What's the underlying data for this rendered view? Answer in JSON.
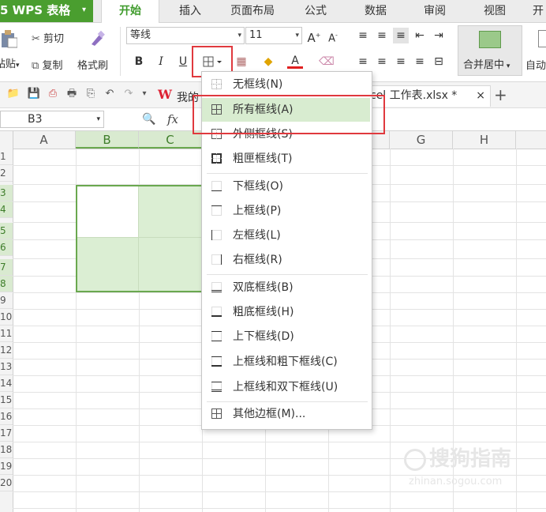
{
  "app_menu": {
    "label": "5 WPS 表格",
    "arrow": "▾"
  },
  "tabs": [
    "开始",
    "插入",
    "页面布局",
    "公式",
    "数据",
    "审阅",
    "视图",
    "开"
  ],
  "ribbon": {
    "cut": "剪切",
    "paste": "粘贴",
    "copy": "复制",
    "format_painter": "格式刷",
    "font_name": "等线",
    "font_size": "11",
    "bold": "B",
    "italic": "I",
    "underline": "U",
    "merge_center": "合并居中",
    "auto_wrap": "自动"
  },
  "quick_access": {
    "doc_tab_left": "我的",
    "doc_tab": "cel 工作表.xlsx *",
    "close": "×",
    "new_tab": "+"
  },
  "formula_bar": {
    "name_box": "B3",
    "fx": "fx"
  },
  "columns": [
    "A",
    "B",
    "C",
    "D",
    "E",
    "F",
    "G",
    "H"
  ],
  "rows": [
    "1",
    "2",
    "3",
    "4",
    "5",
    "6",
    "7",
    "8",
    "9",
    "10",
    "11",
    "12",
    "13",
    "14",
    "15",
    "16",
    "17",
    "18",
    "19",
    "20"
  ],
  "border_menu": {
    "items": [
      {
        "label": "无框线(N)",
        "icon": "no-border-icon"
      },
      {
        "label": "所有框线(A)",
        "icon": "all-borders-icon",
        "highlighted": true
      },
      {
        "label": "外侧框线(S)",
        "icon": "outside-borders-icon"
      },
      {
        "label": "粗匣框线(T)",
        "icon": "thick-box-border-icon"
      },
      {
        "label": "下框线(O)",
        "icon": "bottom-border-icon"
      },
      {
        "label": "上框线(P)",
        "icon": "top-border-icon"
      },
      {
        "label": "左框线(L)",
        "icon": "left-border-icon"
      },
      {
        "label": "右框线(R)",
        "icon": "right-border-icon"
      },
      {
        "label": "双底框线(B)",
        "icon": "double-bottom-border-icon"
      },
      {
        "label": "粗底框线(H)",
        "icon": "thick-bottom-border-icon"
      },
      {
        "label": "上下框线(D)",
        "icon": "top-bottom-border-icon"
      },
      {
        "label": "上框线和粗下框线(C)",
        "icon": "top-thick-bottom-border-icon"
      },
      {
        "label": "上框线和双下框线(U)",
        "icon": "top-double-bottom-border-icon"
      },
      {
        "label": "其他边框(M)...",
        "icon": "more-borders-icon"
      }
    ]
  },
  "watermark": {
    "brand": "搜狗指南",
    "url": "zhinan.sogou.com"
  },
  "colors": {
    "accent": "#4a9e2f",
    "selection_fill": "#dbeed3",
    "highlight": "#e0393e"
  }
}
